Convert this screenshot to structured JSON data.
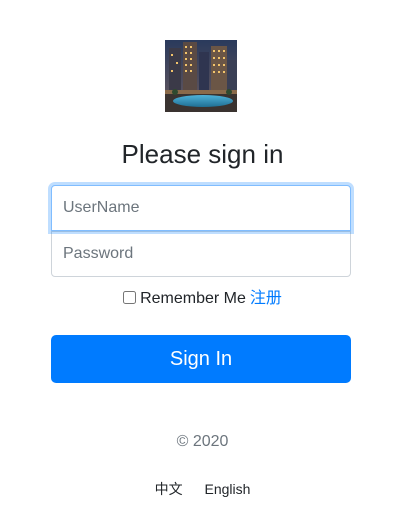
{
  "form": {
    "logo_icon": "hotel-pool-image",
    "title": "Please sign in",
    "username_placeholder": "UserName",
    "password_placeholder": "Password",
    "remember_label": "Remember Me",
    "register_link": "注册",
    "signin_label": "Sign In"
  },
  "footer": {
    "copyright": "© 2020",
    "languages": [
      "中文",
      "English"
    ]
  },
  "colors": {
    "primary": "#007bff",
    "text": "#212529",
    "muted": "#6c757d"
  }
}
